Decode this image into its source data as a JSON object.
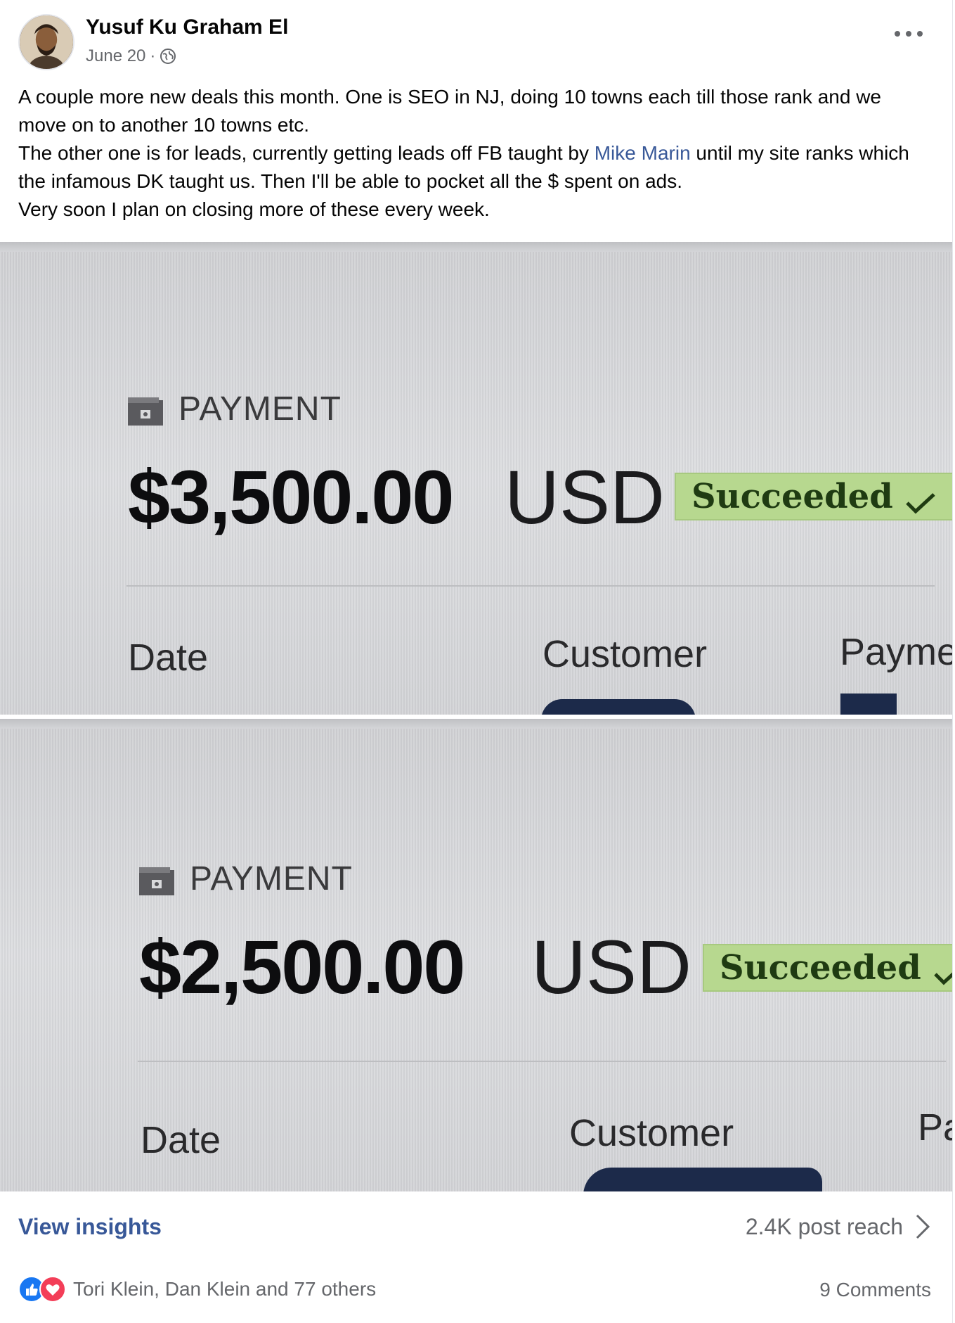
{
  "post": {
    "author": "Yusuf Ku Graham El",
    "date": "June 20",
    "separator": "·",
    "privacy_icon": "globe-icon",
    "more_icon": "more-icon",
    "text": {
      "line1": "A couple more new deals this month. One is SEO in NJ, doing 10 towns each till those rank and we move on to another 10 towns etc.",
      "line2_before": "The other one is for leads, currently getting leads off FB taught by ",
      "line2_mention": "Mike Marin",
      "line2_after": " until my site ranks which the infamous DK taught us. Then I'll be able to pocket all the $ spent on ads.",
      "line3": "Very soon I plan on closing more of these every week."
    }
  },
  "photos": [
    {
      "label": "PAYMENT",
      "amount": "$3,500.00",
      "currency": "USD",
      "status": "Succeeded",
      "columns": [
        "Date",
        "Customer",
        "Payme"
      ]
    },
    {
      "label": "PAYMENT",
      "amount": "$2,500.00",
      "currency": "USD",
      "status": "Succeeded",
      "columns": [
        "Date",
        "Customer",
        "Pa"
      ]
    }
  ],
  "footer": {
    "insights_link": "View insights",
    "reach": "2.4K post reach",
    "reactions_text": "Tori Klein, Dan Klein and 77 others",
    "comments": "9 Comments",
    "colors": {
      "link": "#385898",
      "like": "#1877f2",
      "love": "#f33e58",
      "badge": "#b7d88f"
    }
  }
}
